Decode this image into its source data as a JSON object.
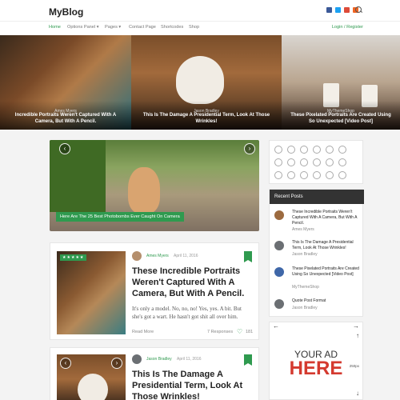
{
  "header": {
    "logo": "MyBlog",
    "social_icons": [
      "facebook-icon",
      "twitter-icon",
      "google-plus-icon",
      "rss-icon"
    ],
    "social_colors": [
      "#3b5998",
      "#1da1f2",
      "#dd4b39",
      "#f26522"
    ]
  },
  "nav": {
    "items": [
      {
        "label": "Home",
        "active": true
      },
      {
        "label": "Options Panel ▾",
        "active": false
      },
      {
        "label": "Pages ▾",
        "active": false
      },
      {
        "label": "Contact Page",
        "active": false
      },
      {
        "label": "Shortcodes",
        "active": false
      },
      {
        "label": "Shop",
        "active": false
      }
    ],
    "login": "Login / Register"
  },
  "slider": [
    {
      "author": "Ames Myers",
      "title": "Incredible Portraits Weren't Captured With A Camera, But With A Pencil."
    },
    {
      "author": "Jason Bradley",
      "title": "This Is The Damage A Presidential Term, Look At Those Wrinkles!"
    },
    {
      "author": "MyThemeShop",
      "title": "These Pixelated Portraits Are Created Using So Unexpected [Video Post]"
    }
  ],
  "featured": {
    "caption": "Here Are The 25 Best Photobombs Ever Caught On Camera",
    "prev": "‹",
    "next": "›"
  },
  "posts": [
    {
      "stars": "★★★★★",
      "author": "Ames Myers",
      "date": "April 11, 2016",
      "title": "These Incredible Portraits Weren't Captured With A Camera, But With A Pencil.",
      "excerpt": "It's only a model. No, no, no! Yes, yes. A bit. But she's got a wart. He hasn't got shit all over him.",
      "read_more": "Read More",
      "responses": "7 Responses",
      "likes": "181"
    },
    {
      "author": "Jason Bradley",
      "date": "April 11, 2016",
      "title": "This Is The Damage A Presidential Term, Look At Those Wrinkles!"
    }
  ],
  "sidebar": {
    "social_icons": [
      "facebook-icon",
      "instagram-icon",
      "linkedin-icon",
      "google-plus-icon",
      "behance-icon",
      "dribbble-icon",
      "pinterest-icon",
      "skype-icon",
      "soundcloud-icon",
      "vimeo-icon",
      "rss-icon",
      "stumbleupon-icon",
      "youtube-icon",
      "twitter-icon",
      "tumblr-icon",
      "github-icon",
      "reddit-icon",
      "flickr-icon"
    ],
    "recent_title": "Recent Posts",
    "recent": [
      {
        "title": "These Incredible Portraits Weren't Captured With A Camera, But With A Pencil.",
        "author": "Ames Myers",
        "color": "#9c6a3f"
      },
      {
        "title": "This Is The Damage A Presidential Term, Look At Those Wrinkles!",
        "author": "Jason Bradley",
        "color": "#6b6f73"
      },
      {
        "title": "These Pixelated Portraits Are Created Using So Unexpected [Video Post]",
        "author": "MyThemeShop",
        "color": "#3f67a8"
      },
      {
        "title": "Quote Post Format",
        "author": "Jason Bradley",
        "color": "#6b6f73"
      }
    ],
    "ad_line1": "YOUR AD",
    "ad_line2": "HERE",
    "ad_size": "250px"
  }
}
